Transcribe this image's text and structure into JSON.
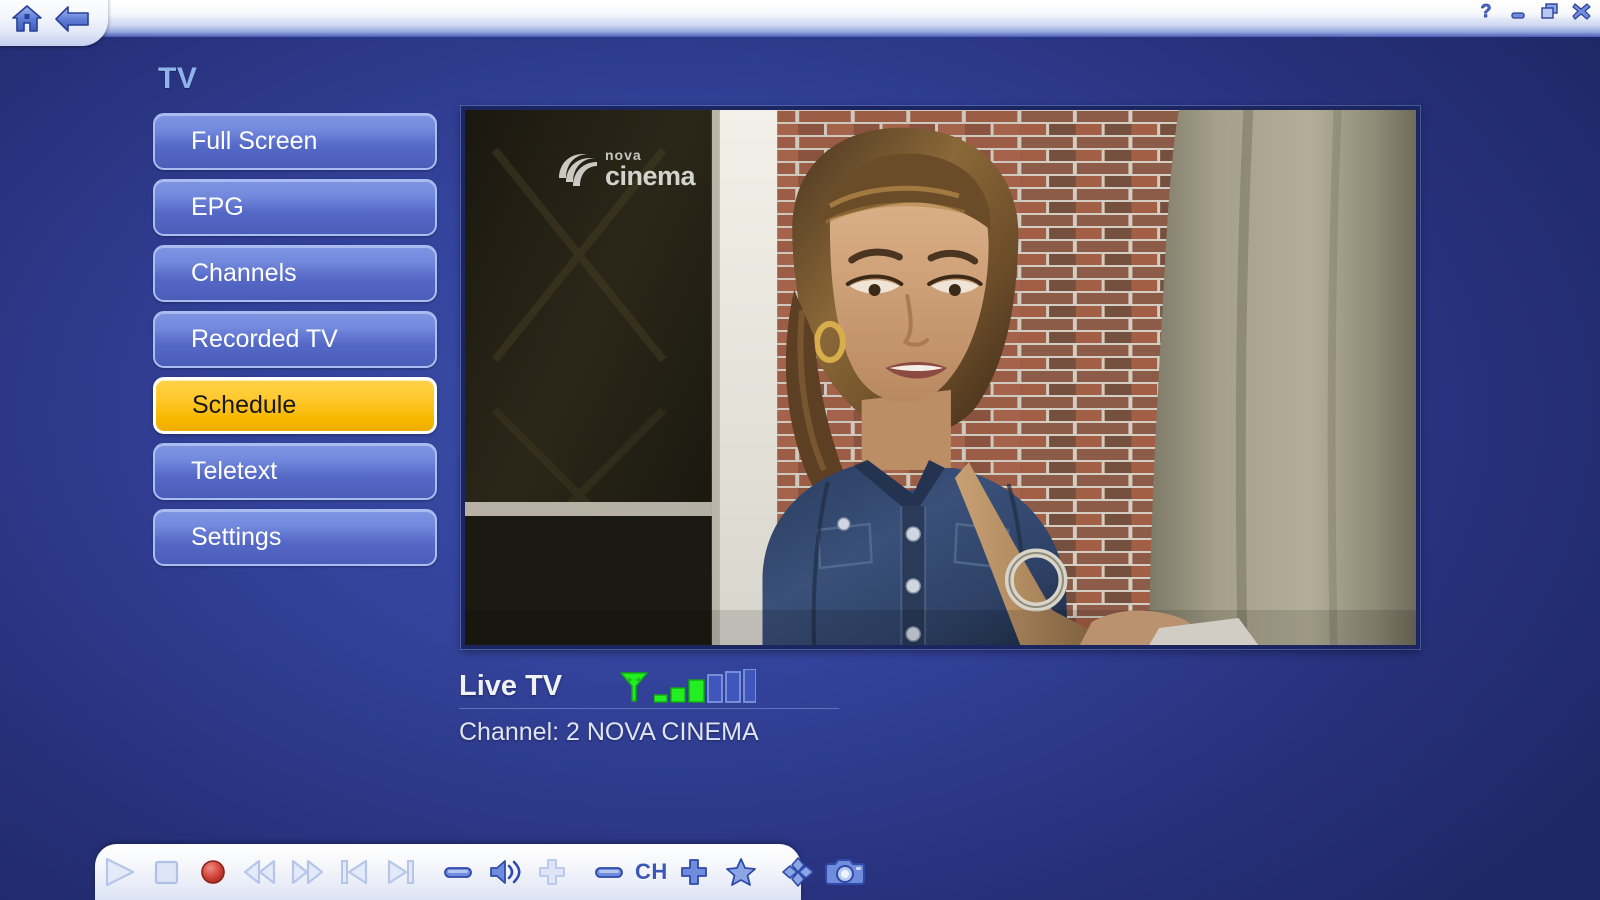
{
  "titlebar": {
    "nav": [
      {
        "name": "home-icon",
        "label": "Home"
      },
      {
        "name": "back-icon",
        "label": "Back"
      }
    ],
    "window_controls": [
      {
        "name": "help-button",
        "glyph": "?",
        "label": "Help"
      },
      {
        "name": "minimize-button",
        "glyph": "_",
        "label": "Minimize"
      },
      {
        "name": "restore-button",
        "glyph": "❐",
        "label": "Restore"
      },
      {
        "name": "close-button",
        "glyph": "✕",
        "label": "Close"
      }
    ]
  },
  "sidebar": {
    "title": "TV",
    "items": [
      {
        "label": "Full Screen",
        "selected": false
      },
      {
        "label": "EPG",
        "selected": false
      },
      {
        "label": "Channels",
        "selected": false
      },
      {
        "label": "Recorded TV",
        "selected": false
      },
      {
        "label": "Schedule",
        "selected": true
      },
      {
        "label": "Teletext",
        "selected": false
      },
      {
        "label": "Settings",
        "selected": false
      }
    ]
  },
  "video": {
    "watermark_line1": "nova",
    "watermark_line2": "cinema",
    "alt": "Woman in denim jacket with beige bag standing in front of a brick wall"
  },
  "info": {
    "source_label": "Live TV",
    "channel_line": "Channel: 2 NOVA CINEMA",
    "signal": {
      "filled_bars": 3,
      "total_bars": 6,
      "antenna_icon": "antenna-icon"
    }
  },
  "toolbar": {
    "groups": [
      {
        "name": "transport-group",
        "buttons": [
          {
            "name": "play-button",
            "icon": "play-icon",
            "label": "Play"
          },
          {
            "name": "stop-button",
            "icon": "stop-icon",
            "label": "Stop"
          },
          {
            "name": "record-button",
            "icon": "record-icon",
            "label": "Record"
          },
          {
            "name": "rewind-button",
            "icon": "rewind-icon",
            "label": "Rewind"
          },
          {
            "name": "fast-forward-button",
            "icon": "fast-forward-icon",
            "label": "Fast Forward"
          },
          {
            "name": "previous-button",
            "icon": "skip-previous-icon",
            "label": "Previous"
          },
          {
            "name": "next-button",
            "icon": "skip-next-icon",
            "label": "Next"
          }
        ]
      },
      {
        "name": "volume-group",
        "buttons": [
          {
            "name": "volume-down-button",
            "icon": "minus-icon",
            "label": "Volume Down"
          },
          {
            "name": "mute-button",
            "icon": "speaker-icon",
            "label": "Mute"
          },
          {
            "name": "volume-up-button",
            "icon": "plus-icon",
            "label": "Volume Up"
          }
        ]
      },
      {
        "name": "channel-group",
        "buttons": [
          {
            "name": "channel-down-button",
            "icon": "minus-icon",
            "label": "Channel Down"
          },
          {
            "name": "channel-label",
            "icon": "text",
            "label": "CH"
          },
          {
            "name": "channel-up-button",
            "icon": "plus-icon",
            "label": "Channel Up"
          },
          {
            "name": "favorites-button",
            "icon": "star-icon",
            "label": "Favorites"
          }
        ]
      },
      {
        "name": "utility-group",
        "buttons": [
          {
            "name": "navigation-pad-button",
            "icon": "dpad-icon",
            "label": "Navigate"
          },
          {
            "name": "snapshot-button",
            "icon": "camera-icon",
            "label": "Snapshot"
          }
        ]
      }
    ]
  },
  "colors": {
    "background_deep": "#1f2866",
    "background_light": "#3c4fa8",
    "menu_button": "#6d84da",
    "menu_border": "#aabdf2",
    "selected_button": "#ffc92f",
    "selected_border": "#ffffff",
    "title_accent": "#8fb4ec",
    "signal_active": "#22ee22",
    "signal_inactive": "#4a63c4",
    "record_red": "#cc3a33",
    "toolbar_icon": "#4864c4"
  }
}
